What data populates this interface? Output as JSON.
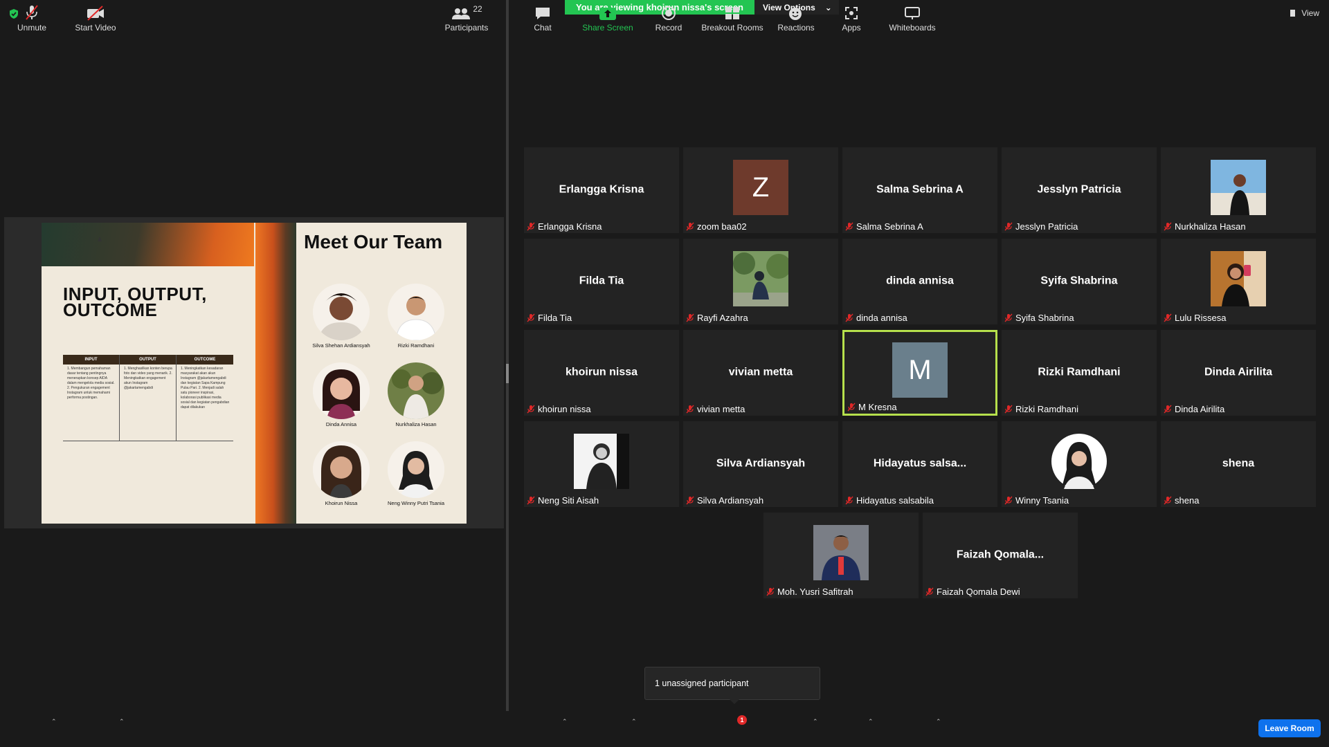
{
  "banner": {
    "viewing": "You are viewing khoirun nissa's screen",
    "options": "View Options"
  },
  "view_label": "View",
  "slide": {
    "title": "INPUT, OUTPUT, OUTCOME",
    "table": {
      "headers": [
        "INPUT",
        "OUTPUT",
        "OUTCOME"
      ],
      "cells": [
        "1. Membangun pemahaman dasar tentang pentingnya menerapkan konsep AIDA dalam mengelola media sosial. 2. Pengukuran engagement Instagram untuk memahami performa postingan.",
        "1. Menghasilkan konten berupa foto dan video yang menarik. 2. Meningkatkan engagement akun Instagram @jakartamengabdi",
        "1. Meningkatkan kesadaran masyarakat akan akun Instagram @jakartamengabdi dan kegiatan Sapa Kampung Pulau Pari. 2. Menjadi salah satu pioneer inspirasi, kolaborasi publikasi media sosial dan kegiatan pengabdian dapat dilakukan"
      ]
    },
    "team_title": "Meet Our Team",
    "members": [
      "Silva Shehan Ardiansyah",
      "Rizki Ramdhani",
      "Dinda Annisa",
      "Nurkhaliza Hasan",
      "Khoirun Nissa",
      "Neng Winny Putri Tsania"
    ]
  },
  "participants": [
    {
      "display": "Erlangga Krisna",
      "label": "Erlangga Krisna"
    },
    {
      "display": "Z",
      "label": "zoom baa02",
      "avatar_color": "#6e3a2c"
    },
    {
      "display": "Salma Sebrina A",
      "label": "Salma Sebrina A"
    },
    {
      "display": "Jesslyn Patricia",
      "label": "Jesslyn Patricia"
    },
    {
      "display": "",
      "label": "Nurkhaliza Hasan",
      "photo": "beach"
    },
    {
      "display": "Filda Tia",
      "label": "Filda Tia"
    },
    {
      "display": "",
      "label": "Rayfi Azahra",
      "photo": "garden"
    },
    {
      "display": "dinda annisa",
      "label": "dinda annisa"
    },
    {
      "display": "Syifa Shabrina",
      "label": "Syifa Shabrina"
    },
    {
      "display": "",
      "label": "Lulu Rissesa",
      "photo": "mirror"
    },
    {
      "display": "khoirun nissa",
      "label": "khoirun nissa"
    },
    {
      "display": "vivian metta",
      "label": "vivian metta"
    },
    {
      "display": "M",
      "label": "M Kresna",
      "avatar_color": "#6a7f8c",
      "active": true
    },
    {
      "display": "Rizki Ramdhani",
      "label": "Rizki Ramdhani"
    },
    {
      "display": "Dinda Airilita",
      "label": "Dinda Airilita"
    },
    {
      "display": "",
      "label": "Neng Siti Aisah",
      "photo": "bw"
    },
    {
      "display": "Silva Ardiansyah",
      "label": "Silva Ardiansyah"
    },
    {
      "display": "Hidayatus  salsa...",
      "label": "Hidayatus salsabila"
    },
    {
      "display": "",
      "label": "Winny Tsania",
      "photo": "hijab"
    },
    {
      "display": "shena",
      "label": "shena"
    },
    {
      "display": "",
      "label": "Moh. Yusri Safitrah",
      "photo": "uniform"
    },
    {
      "display": "Faizah  Qomala...",
      "label": "Faizah Qomala Dewi"
    }
  ],
  "tooltip": "1 unassigned participant",
  "toolbar": {
    "unmute": "Unmute",
    "start_video": "Start Video",
    "participants": "Participants",
    "participants_count": "22",
    "chat": "Chat",
    "share_screen": "Share Screen",
    "record": "Record",
    "breakout_rooms": "Breakout Rooms",
    "breakout_badge": "1",
    "reactions": "Reactions",
    "apps": "Apps",
    "whiteboards": "Whiteboards",
    "leave": "Leave Room"
  },
  "colors": {
    "green": "#23c552",
    "active_border": "#b6e04c",
    "leave": "#0e72ed",
    "tile": "#232323"
  }
}
